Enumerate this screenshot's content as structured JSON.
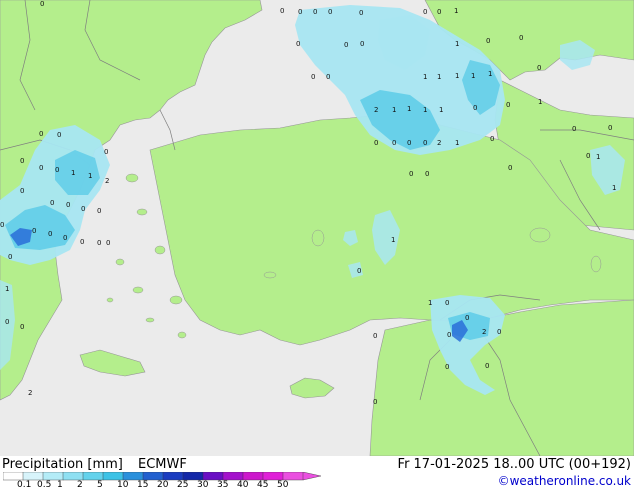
{
  "colors": {
    "land": "#b4ee8c",
    "sea": "#ebebeb",
    "border": "#7f7f7f",
    "coast": "#969696",
    "precip_light": "#a8e6f2",
    "precip_mid": "#60cde8",
    "precip_heavy": "#2a6ed8"
  },
  "footer": {
    "title": "Precipitation [mm]",
    "model": "ECMWF",
    "datetime": "Fr 17-01-2025 18..00 UTC (00+192)",
    "credit": "©weatheronline.co.uk"
  },
  "legend": {
    "ticks": [
      "0.1",
      "0.5",
      "1",
      "2",
      "5",
      "10",
      "15",
      "20",
      "25",
      "30",
      "35",
      "40",
      "45",
      "50"
    ],
    "colors": [
      "#ffffff",
      "#d8f4fb",
      "#b4ecf7",
      "#8fe0f2",
      "#63d2ec",
      "#3cc2e6",
      "#2a90dc",
      "#2260cf",
      "#1b3cc0",
      "#1428a8",
      "#6a0fc4",
      "#a412cc",
      "#cc18cc",
      "#e020d8",
      "#ea50e0"
    ]
  },
  "precip_labels": [
    "0",
    "0",
    "0",
    "0",
    "0",
    "0",
    "0",
    "0",
    "1",
    "0",
    "0",
    "0",
    "1",
    "0",
    "0",
    "0",
    "0",
    "0",
    "0",
    "0",
    "1",
    "1",
    "1",
    "1",
    "1",
    "1",
    "0",
    "0",
    "1",
    "2",
    "1",
    "1",
    "1",
    "0",
    "0",
    "0",
    "0",
    "0",
    "0",
    "0",
    "2",
    "1",
    "0",
    "0",
    "0",
    "0",
    "0",
    "1",
    "1",
    "2",
    "0",
    "0",
    "0",
    "1",
    "1",
    "0",
    "0",
    "0",
    "0",
    "0",
    "0",
    "0",
    "0",
    "0",
    "0",
    "0",
    "0",
    "0",
    "1",
    "0",
    "1",
    "1",
    "0",
    "0",
    "0",
    "0",
    "0",
    "2",
    "0",
    "0",
    "0",
    "0",
    "2",
    "0"
  ]
}
